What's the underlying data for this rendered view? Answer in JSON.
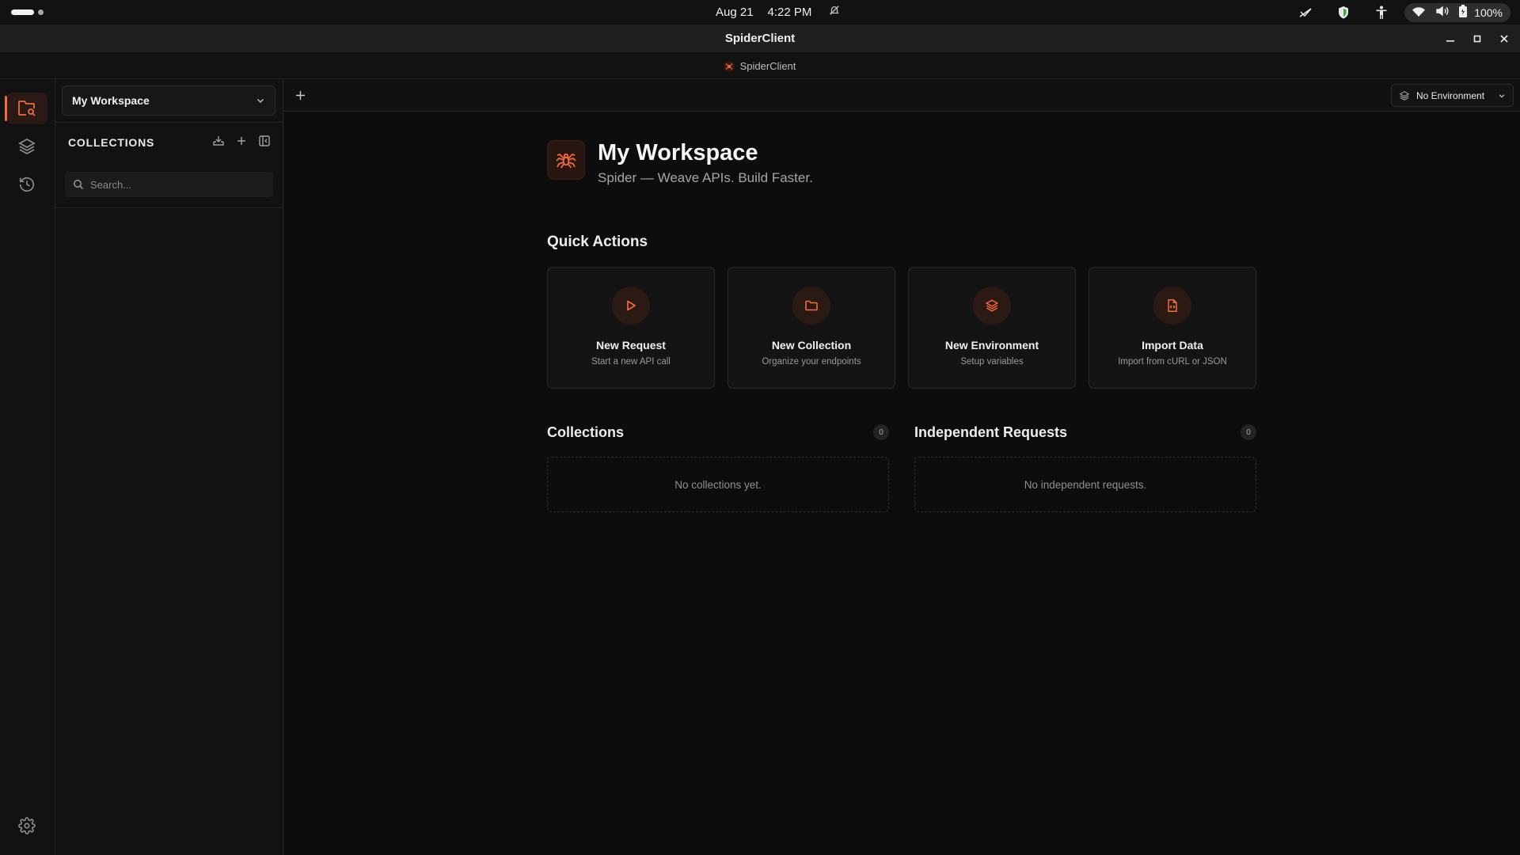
{
  "os": {
    "date": "Aug 21",
    "time": "4:22 PM",
    "battery": "100%"
  },
  "window": {
    "title": "SpiderClient",
    "app_header": "SpiderClient"
  },
  "sidebar": {
    "workspace": "My Workspace",
    "section_label": "COLLECTIONS",
    "search_placeholder": "Search..."
  },
  "tabs": {
    "environment": "No Environment"
  },
  "main": {
    "title": "My Workspace",
    "tagline": "Spider — Weave APIs. Build Faster.",
    "quick_actions_title": "Quick Actions",
    "quick_actions": [
      {
        "title": "New Request",
        "subtitle": "Start a new API call",
        "icon": "play-icon"
      },
      {
        "title": "New Collection",
        "subtitle": "Organize your endpoints",
        "icon": "folder-icon"
      },
      {
        "title": "New Environment",
        "subtitle": "Setup variables",
        "icon": "layers-icon"
      },
      {
        "title": "Import Data",
        "subtitle": "Import from cURL or JSON",
        "icon": "file-code-icon"
      }
    ],
    "collections": {
      "title": "Collections",
      "count": "0",
      "empty": "No collections yet."
    },
    "independent": {
      "title": "Independent Requests",
      "count": "0",
      "empty": "No independent requests."
    }
  },
  "colors": {
    "accent": "#f26a3d",
    "background": "#0d0d0d",
    "panel": "#121212"
  }
}
